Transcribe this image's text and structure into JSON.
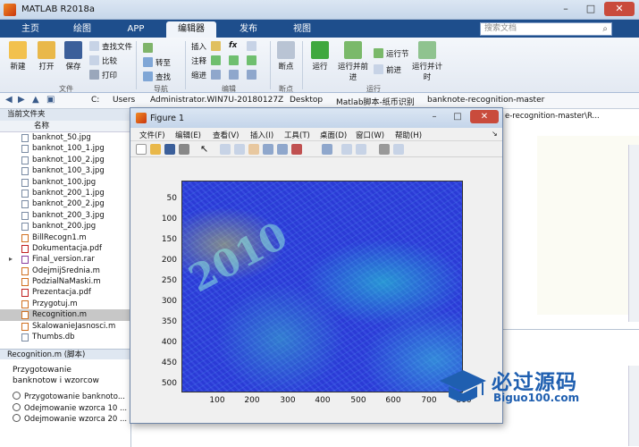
{
  "window": {
    "title": "MATLAB R2018a",
    "minimize": "–",
    "maximize": "□",
    "close": "✕"
  },
  "ribbon_tabs": [
    "主页",
    "绘图",
    "APP",
    "编辑器",
    "发布",
    "视图"
  ],
  "search_placeholder": "搜索文档",
  "ribbon": {
    "file_group": {
      "new": "新建",
      "open": "打开",
      "save": "保存",
      "find_files": "查找文件",
      "compare": "比较",
      "print": "打印",
      "label": "文件"
    },
    "nav_group": {
      "goto": "转至",
      "find": "查找",
      "label": "导航"
    },
    "edit_group": {
      "insert": "插入",
      "fx": "fx",
      "comment": "注释",
      "indent": "缩进",
      "label": "编辑"
    },
    "breakpoints_group": {
      "breakpoints": "断点",
      "label": "断点"
    },
    "run_group": {
      "run": "运行",
      "run_advance": "运行并前进",
      "run_section": "运行节",
      "advance": "前进",
      "run_time": "运行并计时",
      "label": "运行"
    }
  },
  "address": {
    "crumbs": [
      "C:",
      "Users",
      "Administrator.WIN7U-20180127Z",
      "Desktop",
      "Matlab脚本-纸币识别",
      "banknote-recognition-master"
    ]
  },
  "folder_panel": {
    "title": "当前文件夹",
    "column": "名称",
    "files": [
      "banknot_50.jpg",
      "banknot_100_1.jpg",
      "banknot_100_2.jpg",
      "banknot_100_3.jpg",
      "banknot_100.jpg",
      "banknot_200_1.jpg",
      "banknot_200_2.jpg",
      "banknot_200_3.jpg",
      "banknot_200.jpg",
      "BillRecogn1.m",
      "Dokumentacja.pdf",
      "Final_version.rar",
      "OdejmijSrednia.m",
      "PodzialNaMaski.m",
      "Prezentacja.pdf",
      "Przygotuj.m",
      "Recognition.m",
      "SkalowanieJasnosci.m",
      "Thumbs.db"
    ],
    "selected": "Recognition.m"
  },
  "details": {
    "title": "Recognition.m  (脚本)",
    "description": "Przygotowanie banknotow i wzorcow",
    "items": [
      "Przygotowanie banknoto...",
      "Odejmowanie wzorca 10 ...",
      "Odejmowanie wzorca 20 ..."
    ]
  },
  "editor": {
    "tab_text": "e-recognition-master\\R..."
  },
  "figure": {
    "title": "Figure 1",
    "menu": [
      "文件(F)",
      "编辑(E)",
      "查看(V)",
      "插入(I)",
      "工具(T)",
      "桌面(D)",
      "窗口(W)",
      "帮助(H)"
    ],
    "yticks": [
      "50",
      "100",
      "150",
      "200",
      "250",
      "300",
      "350",
      "400",
      "450",
      "500"
    ],
    "xticks": [
      "100",
      "200",
      "300",
      "400",
      "500",
      "600",
      "700",
      "800"
    ],
    "image_overlay": "2010"
  },
  "watermark": {
    "brand": "必过源码",
    "url": "Biguo100.com"
  }
}
